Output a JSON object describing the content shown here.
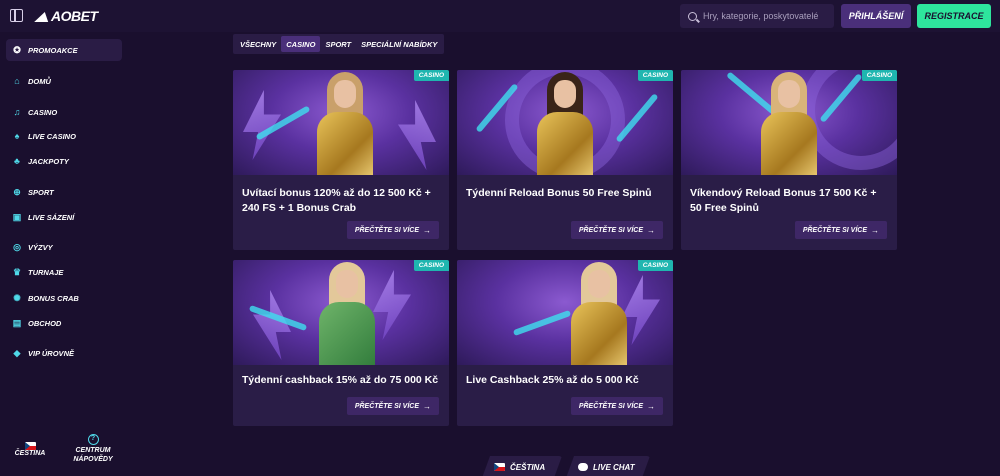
{
  "header": {
    "logo": "AOBET",
    "search_placeholder": "Hry, kategorie, poskytovatelé",
    "login_label": "PŘIHLÁŠENÍ",
    "register_label": "REGISTRACE"
  },
  "sidebar": {
    "items": [
      {
        "label": "PROMOAKCE",
        "icon": "gift-icon"
      },
      {
        "label": "DOMŮ",
        "icon": "home-icon"
      },
      {
        "label": "CASINO",
        "icon": "music-note-icon"
      },
      {
        "label": "LIVE CASINO",
        "icon": "cards-icon"
      },
      {
        "label": "JACKPOTY",
        "icon": "clover-icon"
      },
      {
        "label": "SPORT",
        "icon": "controller-icon"
      },
      {
        "label": "LIVE SÁZENÍ",
        "icon": "live-icon"
      },
      {
        "label": "VÝZVY",
        "icon": "medal-icon"
      },
      {
        "label": "TURNAJE",
        "icon": "trophy-icon"
      },
      {
        "label": "BONUS CRAB",
        "icon": "crab-icon"
      },
      {
        "label": "OBCHOD",
        "icon": "shop-icon"
      },
      {
        "label": "VIP ÚROVNĚ",
        "icon": "diamond-icon"
      }
    ],
    "language": "ČEŠTINA",
    "help": "CENTRUM NÁPOVĚDY"
  },
  "tabs": [
    {
      "label": "VŠECHNY",
      "active": false
    },
    {
      "label": "CASINO",
      "active": true
    },
    {
      "label": "SPORT",
      "active": false
    },
    {
      "label": "SPECIÁLNÍ NABÍDKY",
      "active": false
    }
  ],
  "cards": [
    {
      "badge": "CASINO",
      "title": "Uvítací bonus 120% až do 12 500 Kč + 240 FS + 1 Bonus Crab",
      "button": "PŘEČTĚTE SI VÍCE"
    },
    {
      "badge": "CASINO",
      "title": "Týdenní Reload Bonus 50 Free Spinů",
      "button": "PŘEČTĚTE SI VÍCE"
    },
    {
      "badge": "CASINO",
      "title": "Víkendový Reload Bonus 17 500 Kč + 50 Free Spinů",
      "button": "PŘEČTĚTE SI VÍCE"
    },
    {
      "badge": "CASINO",
      "title": "Týdenní cashback 15% až do 75 000 Kč",
      "button": "PŘEČTĚTE SI VÍCE"
    },
    {
      "badge": "CASINO",
      "title": "Live Cashback 25% až do 5 000 Kč",
      "button": "PŘEČTĚTE SI VÍCE"
    }
  ],
  "footer_bar": {
    "language": "ČEŠTINA",
    "chat": "LIVE CHAT"
  },
  "colors": {
    "background": "#1a0f2e",
    "card": "#2a1d47",
    "accent_green": "#2ee59d",
    "badge_teal": "#1fb6b0",
    "icon_cyan": "#4fd8e8"
  }
}
